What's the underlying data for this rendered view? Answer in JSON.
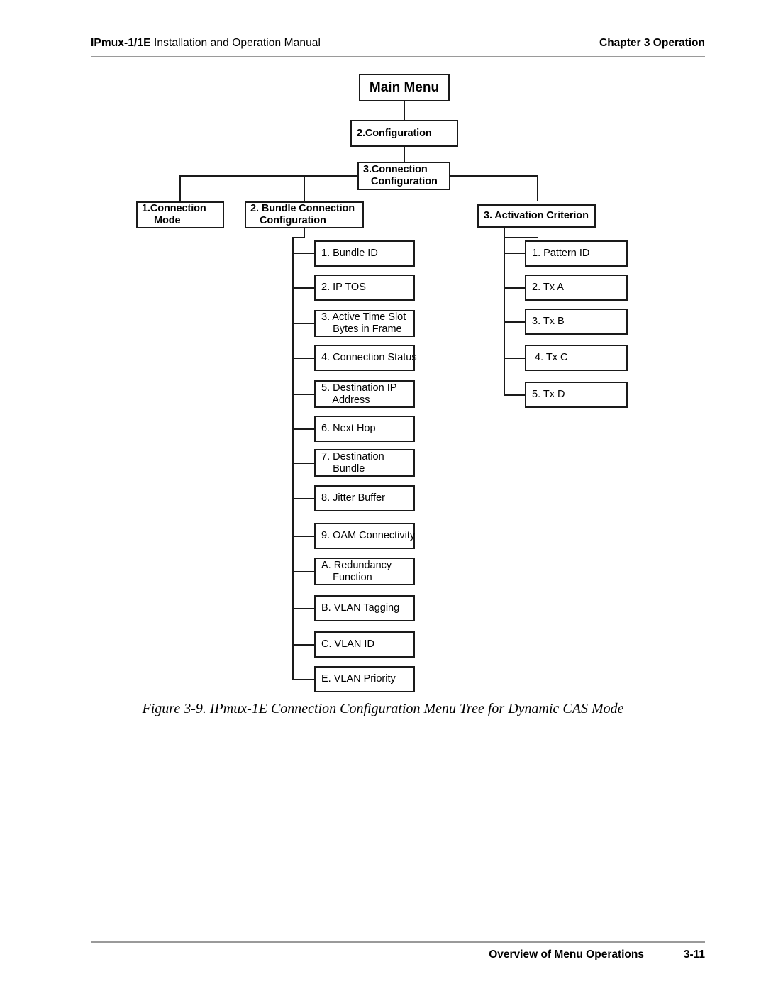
{
  "header": {
    "left_bold": "IPmux-1/1E",
    "left_rest": " Installation and Operation Manual",
    "right": "Chapter 3  Operation"
  },
  "footer": {
    "text": "Overview of Menu Operations",
    "page": "3-11"
  },
  "figure": {
    "caption": "Figure 3-9.  IPmux-1E Connection Configuration Menu Tree for Dynamic CAS Mode"
  },
  "diagram": {
    "root": "Main Menu",
    "level1": "2.Configuration",
    "level2_line1": "3.Connection",
    "level2_line2": "Configuration",
    "branches": {
      "connection_mode_line1": "1.Connection",
      "connection_mode_line2": "Mode",
      "bundle_config_line1": "2. Bundle Connection",
      "bundle_config_line2": "Configuration",
      "activation_criterion": "3. Activation Criterion"
    },
    "bundle_items": [
      {
        "line1": "1. Bundle ID",
        "line2": ""
      },
      {
        "line1": "2. IP TOS",
        "line2": ""
      },
      {
        "line1": "3. Active Time Slot",
        "line2": "    Bytes in Frame"
      },
      {
        "line1": "4. Connection Status",
        "line2": ""
      },
      {
        "line1": "5. Destination IP",
        "line2": "    Address"
      },
      {
        "line1": "6. Next Hop",
        "line2": ""
      },
      {
        "line1": "7. Destination",
        "line2": "    Bundle"
      },
      {
        "line1": "8. Jitter Buffer",
        "line2": ""
      },
      {
        "line1": "9. OAM Connectivity",
        "line2": ""
      },
      {
        "line1": "A. Redundancy",
        "line2": "    Function"
      },
      {
        "line1": "B. VLAN Tagging",
        "line2": ""
      },
      {
        "line1": "C. VLAN ID",
        "line2": ""
      },
      {
        "line1": "E. VLAN Priority",
        "line2": ""
      }
    ],
    "activation_items": [
      {
        "line1": "1. Pattern ID"
      },
      {
        "line1": "2. Tx A"
      },
      {
        "line1": "3. Tx B"
      },
      {
        "line1": "4. Tx C"
      },
      {
        "line1": "5. Tx D"
      }
    ]
  }
}
